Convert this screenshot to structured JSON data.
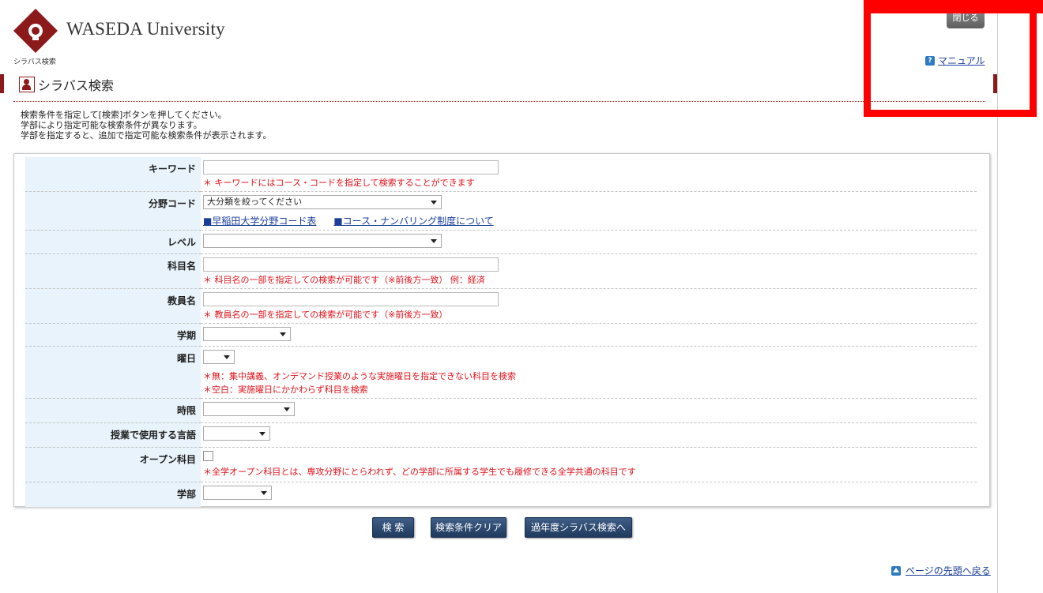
{
  "header": {
    "logo_text": "WASEDA University",
    "breadcrumb": "シラバス検索",
    "close_label": "閉じる",
    "manual_icon": "?",
    "manual_label": "マニュアル"
  },
  "page_title": "シラバス検索",
  "instructions": [
    "検索条件を指定して[検索]ボタンを押してください。",
    "学部により指定可能な検索条件が異なります。",
    "学部を指定すると、追加で指定可能な検索条件が表示されます。"
  ],
  "form": {
    "keyword": {
      "label": "キーワード",
      "value": "",
      "note": "＊ キーワードにはコース・コードを指定して検索することができます"
    },
    "field_code": {
      "label": "分野コード",
      "selected": "大分類を絞ってください",
      "link1": "■早稲田大学分野コード表",
      "link2": "■コース・ナンバリング制度について"
    },
    "level": {
      "label": "レベル",
      "selected": ""
    },
    "subject": {
      "label": "科目名",
      "value": "",
      "note": "＊ 科目名の一部を指定しての検索が可能です（※前後方一致） 例：経済"
    },
    "teacher": {
      "label": "教員名",
      "value": "",
      "note": "＊ 教員名の一部を指定しての検索が可能です（※前後方一致）"
    },
    "term": {
      "label": "学期",
      "selected": ""
    },
    "day": {
      "label": "曜日",
      "selected": "",
      "note1": "＊無：集中講義、オンデマンド授業のような実施曜日を指定できない科目を検索",
      "note2": "＊空白：実施曜日にかかわらず科目を検索"
    },
    "period": {
      "label": "時限",
      "selected": ""
    },
    "language": {
      "label": "授業で使用する言語",
      "selected": ""
    },
    "open_course": {
      "label": "オープン科目",
      "checked": false,
      "note": "＊全学オープン科目とは、専攻分野にとらわれず、どの学部に所属する学生でも履修できる全学共通の科目です"
    },
    "faculty": {
      "label": "学部",
      "selected": ""
    }
  },
  "buttons": {
    "search": "検 索",
    "clear": "検索条件クリア",
    "past": "過年度シラバス検索へ"
  },
  "to_top": "ページの先頭へ戻る",
  "colors": {
    "brand": "#8c1a1a",
    "label_bg": "#e8f3fb",
    "note_red": "#e0131b",
    "button": "#2a476c",
    "highlight": "#ff0000"
  }
}
